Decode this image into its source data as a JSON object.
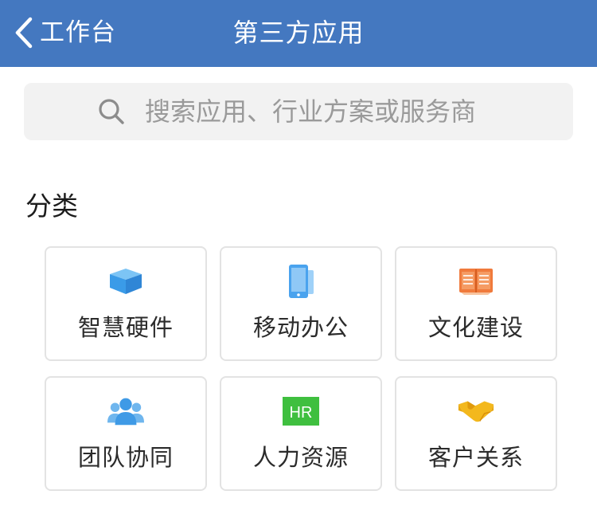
{
  "header": {
    "back_label": "工作台",
    "title": "第三方应用",
    "background_color": "#4478c0"
  },
  "search": {
    "placeholder": "搜索应用、行业方案或服务商",
    "value": "",
    "icon": "search-icon"
  },
  "category": {
    "title": "分类",
    "items": [
      {
        "label": "智慧硬件",
        "icon": "cube-icon",
        "color": "#3a9be8"
      },
      {
        "label": "移动办公",
        "icon": "mobile-devices-icon",
        "color": "#4aa3ee"
      },
      {
        "label": "文化建设",
        "icon": "open-book-icon",
        "color": "#f07a3c"
      },
      {
        "label": "团队协同",
        "icon": "team-icon",
        "color": "#3f9ae6"
      },
      {
        "label": "人力资源",
        "icon": "hr-icon",
        "color": "#3fbf3f",
        "icon_text": "HR"
      },
      {
        "label": "客户关系",
        "icon": "handshake-icon",
        "color": "#f3b81d"
      }
    ]
  }
}
